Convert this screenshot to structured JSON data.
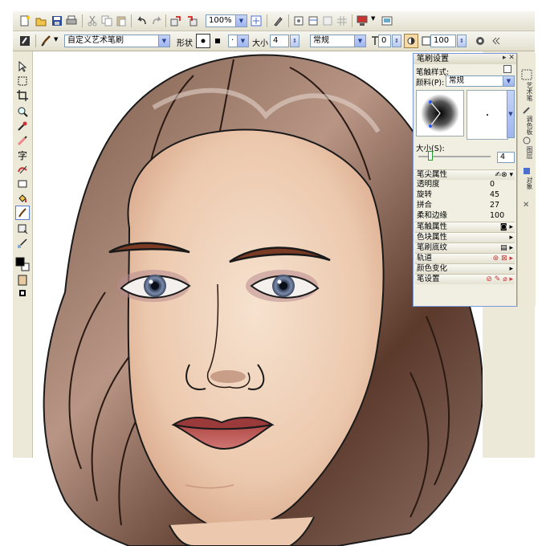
{
  "toolbar_top": {
    "zoom_value": "100%"
  },
  "toolbar_props": {
    "brush_name": "自定义艺术笔刷",
    "shape_label": "形状",
    "size_label": "大小",
    "size_value": "4",
    "blend_value": "常规",
    "opacity_value": "0",
    "opacity2_value": "100"
  },
  "panel": {
    "title": "笔刷设置",
    "nib_style_label": "笔触样式:",
    "paint_label": "颜料(P):",
    "paint_value": "常规",
    "size_label": "大小(S):",
    "size_value": "4",
    "sections": [
      {
        "label": "笔尖属性",
        "value": ""
      },
      {
        "label": "透明度",
        "value": "0"
      },
      {
        "label": "旋转",
        "value": "45"
      },
      {
        "label": "拼合",
        "value": "27"
      },
      {
        "label": "柔和边缘",
        "value": "100"
      },
      {
        "label": "笔触属性",
        "value": ""
      },
      {
        "label": "色块属性",
        "value": ""
      },
      {
        "label": "笔刷底纹",
        "value": ""
      },
      {
        "label": "轨道",
        "value": ""
      },
      {
        "label": "颜色变化",
        "value": ""
      },
      {
        "label": "笔设置",
        "value": ""
      }
    ]
  },
  "siderail": {
    "tabs": [
      "艺术笔",
      "调色板",
      "图层",
      "对象"
    ]
  },
  "colors": {
    "panel_border": "#7a96df",
    "toolbar_bg": "#ece9d8",
    "spin_blue": "#b6c7f0"
  }
}
